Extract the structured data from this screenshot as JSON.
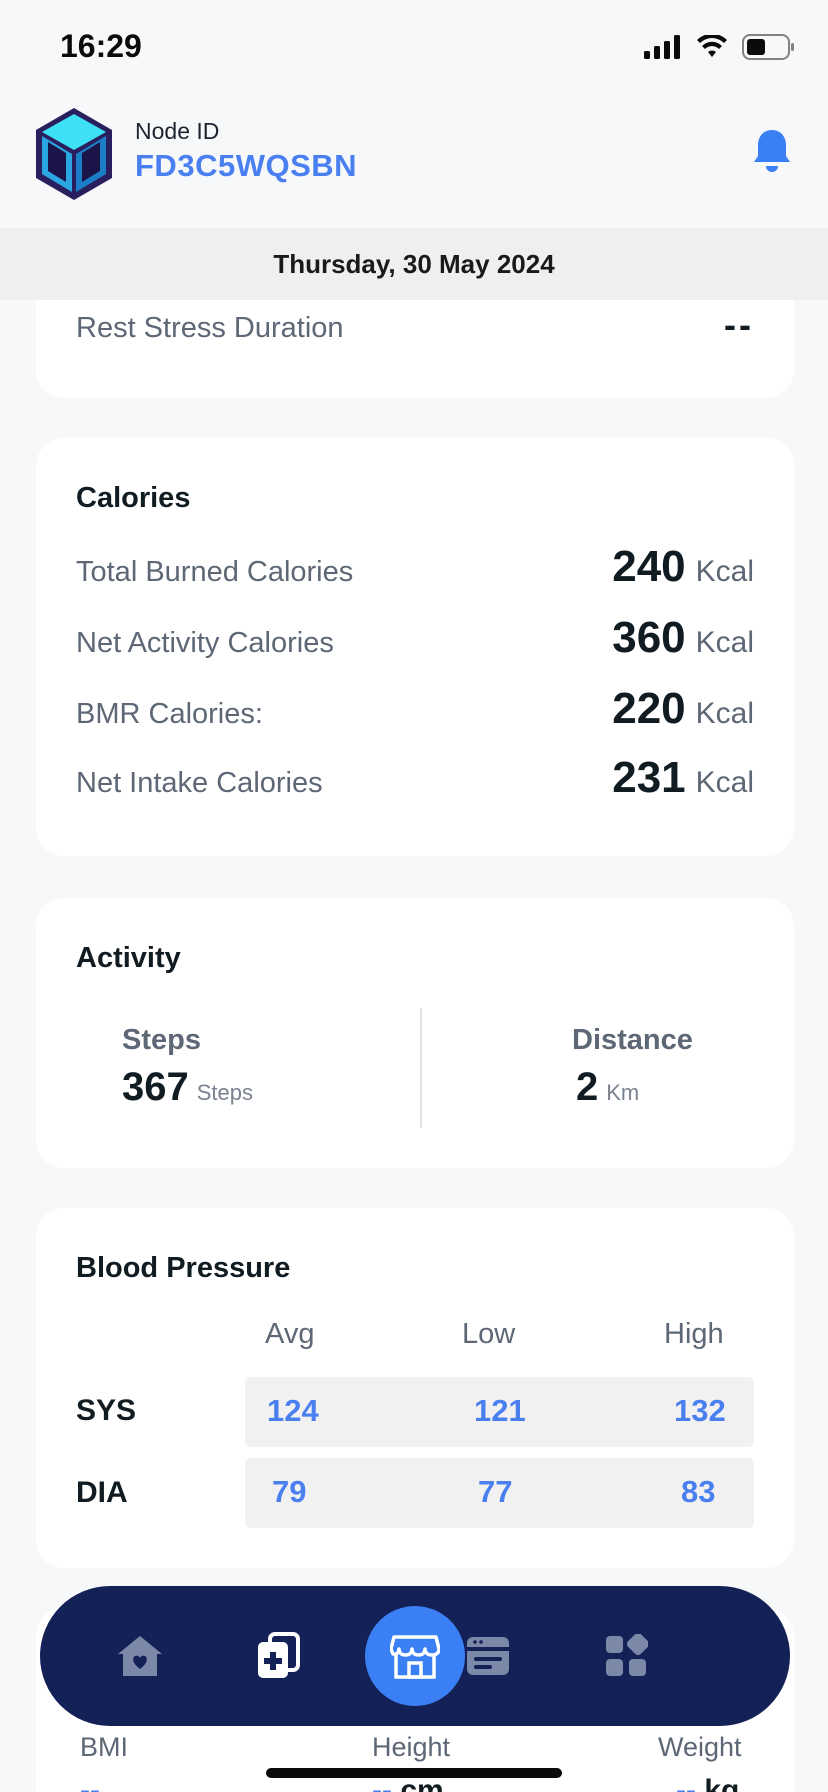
{
  "status_bar": {
    "time": "16:29"
  },
  "header": {
    "node_label": "Node ID",
    "node_id": "FD3C5WQSBN"
  },
  "date": "Thursday, 30 May 2024",
  "stress": {
    "label": "Rest Stress Duration",
    "value": "--"
  },
  "calories": {
    "title": "Calories",
    "rows": [
      {
        "label": "Total Burned Calories",
        "value": "240",
        "unit": "Kcal"
      },
      {
        "label": "Net Activity Calories",
        "value": "360",
        "unit": "Kcal"
      },
      {
        "label": "BMR Calories:",
        "value": "220",
        "unit": "Kcal"
      },
      {
        "label": "Net Intake Calories",
        "value": "231",
        "unit": "Kcal"
      }
    ]
  },
  "activity": {
    "title": "Activity",
    "steps": {
      "label": "Steps",
      "value": "367",
      "unit": "Steps"
    },
    "distance": {
      "label": "Distance",
      "value": "2",
      "unit": "Km"
    }
  },
  "blood_pressure": {
    "title": "Blood Pressure",
    "columns": [
      "Avg",
      "Low",
      "High"
    ],
    "rows": [
      {
        "label": "SYS",
        "values": [
          "124",
          "121",
          "132"
        ]
      },
      {
        "label": "DIA",
        "values": [
          "79",
          "77",
          "83"
        ]
      }
    ]
  },
  "body": {
    "bmi": {
      "label": "BMI",
      "value": "--"
    },
    "height": {
      "label": "Height",
      "value": "--",
      "unit": "cm"
    },
    "weight": {
      "label": "Weight",
      "value": "--",
      "unit": "kg"
    }
  },
  "nav": {
    "items": [
      "home-icon",
      "medical-records-icon",
      "store-icon",
      "card-icon",
      "apps-grid-icon"
    ],
    "active": "store-icon"
  },
  "colors": {
    "accent": "#4a7ff0",
    "nav_bg": "#142157",
    "nav_active": "#3b7ff5",
    "bell": "#3b7ff5"
  }
}
